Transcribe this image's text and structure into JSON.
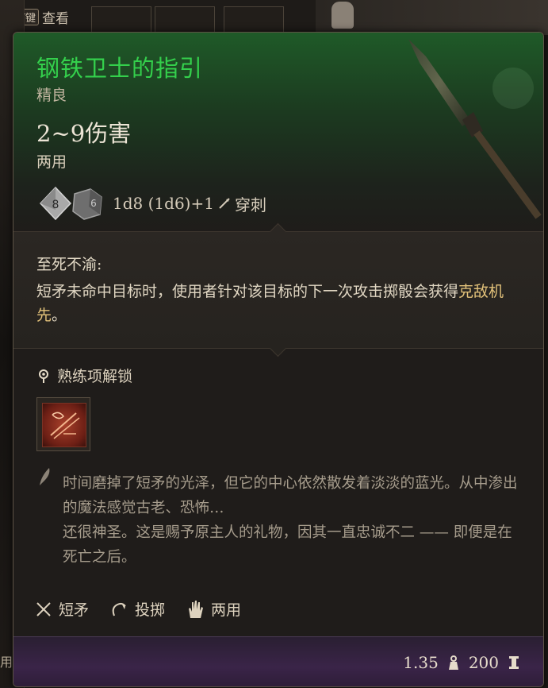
{
  "background": {
    "top_key_label": "T键",
    "top_key_action": "查看",
    "left_edge_text": "用"
  },
  "tooltip": {
    "item_name": "钢铁卫士的指引",
    "rarity": "精良",
    "damage": "2~9伤害",
    "handedness": "两用",
    "dice": {
      "d8_face": "8",
      "d6_face": "6",
      "formula": "1d8 (1d6)+1",
      "damage_type": "穿刺"
    },
    "special": {
      "title": "至死不渝:",
      "text_before": "短矛未命中目标时，使用者针对该目标的下一次攻击掷骰会获得",
      "highlight": "克敌机先",
      "text_after": "。"
    },
    "proficiency": {
      "label": "熟练项解锁"
    },
    "lore": {
      "line1": "时间磨掉了短矛的光泽，但它的中心依然散发着淡淡的蓝光。从中渗出的魔法感觉古老、恐怖…",
      "line2": "还很神圣。这是赐予原主人的礼物，因其一直忠诚不二 —— 即便是在死亡之后。"
    },
    "tags": [
      {
        "icon": "spear-cross-icon",
        "label": "短矛"
      },
      {
        "icon": "throw-icon",
        "label": "投掷"
      },
      {
        "icon": "hand-icon",
        "label": "两用"
      }
    ],
    "footer": {
      "weight": "1.35",
      "price": "200"
    },
    "colors": {
      "name": "#34d04c",
      "highlight": "#e3c27a",
      "header_green": "#1f5a28",
      "footer_purple": "#3a2448"
    }
  }
}
